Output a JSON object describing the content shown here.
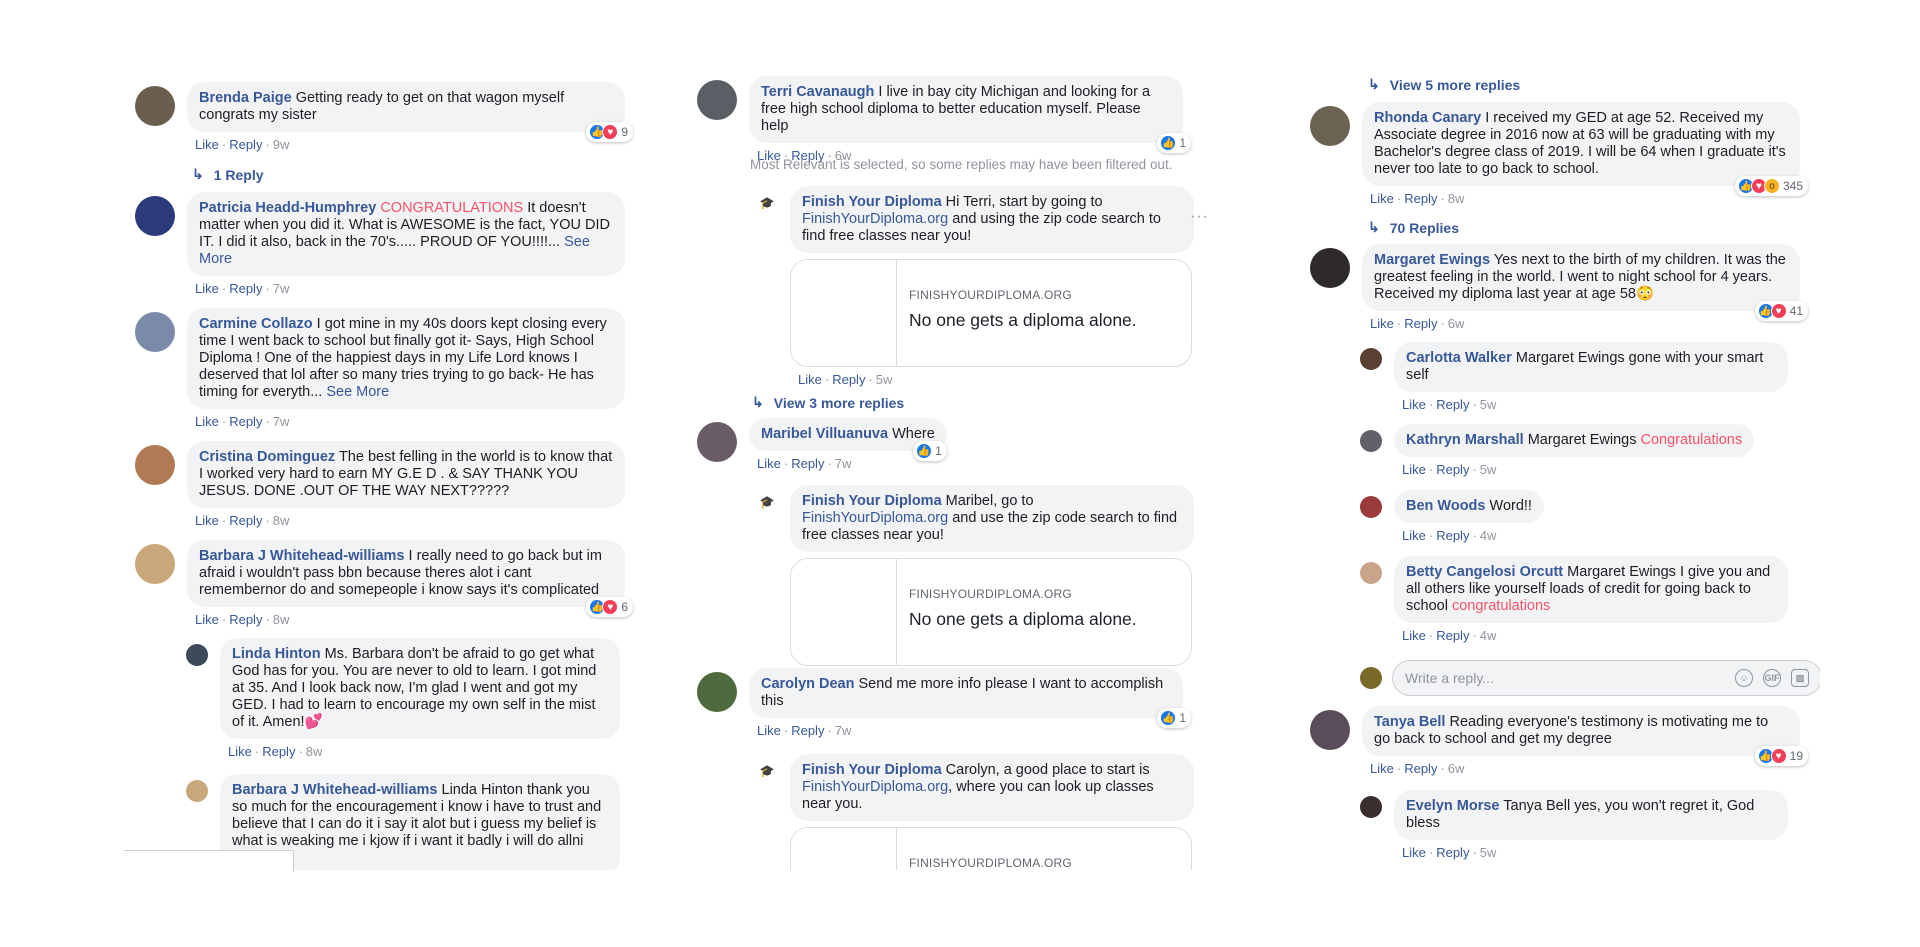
{
  "actions": {
    "like": "Like",
    "reply": "Reply",
    "dot": "·"
  },
  "colors": {
    "name": "#385898",
    "highlight": "#f35369",
    "bubble": "#f2f3f5"
  },
  "col1": {
    "comments": [
      {
        "name": "Brenda Paige",
        "text": "Getting ready to get on that wagon myself congrats my sister",
        "time": "9w",
        "reactions": {
          "icons": [
            "like",
            "love"
          ],
          "count": "9"
        }
      },
      {
        "replies_label": "1 Reply"
      },
      {
        "name": "Patricia Headd-Humphrey",
        "highlight": "CONGRATULATIONS",
        "text": "It doesn't matter when you did it. What is AWESOME is the fact, YOU DID IT. I did it also, back in the 70's..... PROUD OF YOU!!!!...",
        "see_more": "See More",
        "time": "7w"
      },
      {
        "name": "Carmine Collazo",
        "text": "I got mine in my 40s doors kept closing every time I went back to school but finally got it- Says, High School Diploma ! One of the happiest days in my Life Lord knows I deserved that lol after so many tries trying to go back- He has timing for everyth...",
        "see_more": "See More",
        "time": "7w"
      },
      {
        "name": "Cristina Dominguez",
        "text": "The best felling in the world is to know that I worked very hard to earn MY G.E D . & SAY THANK YOU JESUS. DONE .OUT OF THE WAY NEXT?????",
        "time": "8w"
      },
      {
        "name": "Barbara J Whitehead-williams",
        "text": "I really need to go back but im afraid i wouldn't pass bbn because theres alot i cant remembernor do and somepeople i know says it's complicated",
        "time": "8w",
        "reactions": {
          "icons": [
            "like",
            "love"
          ],
          "count": "6"
        }
      },
      {
        "name": "Linda Hinton",
        "text": "Ms. Barbara don't be afraid to go get what God has for you. You are never to old to learn. I got mind at 35. And I look back now, I'm glad I went and got my GED. I had to learn to encourage my own self in the mist of it. Amen!💕",
        "time": "8w"
      },
      {
        "name": "Barbara J Whitehead-williams",
        "text": "Linda Hinton thank you so much for the encouragement i know i have to trust and believe that I can do it i say it alot but i guess my belief is what is weaking me i kjow if i want it badly i will do allni can it"
      }
    ]
  },
  "col2": {
    "terri": {
      "name": "Terri Cavanaugh",
      "text": "I live in bay city Michigan and looking for a free high school diploma to better education myself. Please help",
      "time": "6w",
      "count": "1"
    },
    "filter_note": "Most Relevant is selected, so some replies may have been filtered out.",
    "fyd1": {
      "name": "Finish Your Diploma",
      "text_a": "Hi Terri, start by going to",
      "link": "FinishYourDiploma.org",
      "text_b": "and using the zip code search to find free classes near you!",
      "time": "5w"
    },
    "card": {
      "domain": "FINISHYOURDIPLOMA.ORG",
      "title": "No one gets a diploma alone."
    },
    "more_dots": "···",
    "view_more": "View 3 more replies",
    "maribel": {
      "name": "Maribel Villuanuva",
      "text": "Where",
      "time": "7w",
      "count": "1"
    },
    "fyd2": {
      "name": "Finish Your Diploma",
      "text_a": "Maribel, go to",
      "link": "FinishYourDiploma.org",
      "text_b": "and use the zip code search to find free classes near you!",
      "time": "5w"
    },
    "carolyn": {
      "name": "Carolyn Dean",
      "text": "Send me more info please I want to accomplish this",
      "time": "7w",
      "count": "1"
    },
    "fyd3": {
      "name": "Finish Your Diploma",
      "text_a": "Carolyn, a good place to start is",
      "link": "FinishYourDiploma.org",
      "text_b": ", where you can look up classes near you."
    }
  },
  "col3": {
    "view_more": "View 5 more replies",
    "rhonda": {
      "name": "Rhonda Canary",
      "text": "I received my GED at age 52. Received my Associate degree in 2016 now at 63 will be graduating with my Bachelor's degree class of 2019. I will be 64 when I graduate it's never too late to go back to school.",
      "time": "8w",
      "count": "345"
    },
    "replies_label": "70 Replies",
    "margaret": {
      "name": "Margaret Ewings",
      "text": "Yes next to the birth of my children. It was the greatest feeling in the world. I went to night school for 4 years. Received my diploma last year at age 58😳",
      "time": "6w",
      "count": "41"
    },
    "carlotta": {
      "name": "Carlotta Walker",
      "text": "Margaret Ewings gone with your smart self",
      "time": "5w"
    },
    "kathryn": {
      "name": "Kathryn Marshall",
      "text": "Margaret Ewings",
      "highlight": "Congratulations",
      "time": "5w"
    },
    "ben": {
      "name": "Ben Woods",
      "text": "Word!!",
      "time": "4w"
    },
    "betty": {
      "name": "Betty Cangelosi Orcutt",
      "text": "Margaret Ewings I give you and all others like yourself loads of credit for going back to school",
      "highlight": "congratulations",
      "time": "4w"
    },
    "write_placeholder": "Write a reply...",
    "tanya": {
      "name": "Tanya Bell",
      "text": "Reading everyone's testimony is motivating me to go back to school and get my degree",
      "time": "6w",
      "count": "19"
    },
    "evelyn": {
      "name": "Evelyn Morse",
      "text": "Tanya Bell yes, you won't regret it, God bless",
      "time": "5w"
    }
  }
}
